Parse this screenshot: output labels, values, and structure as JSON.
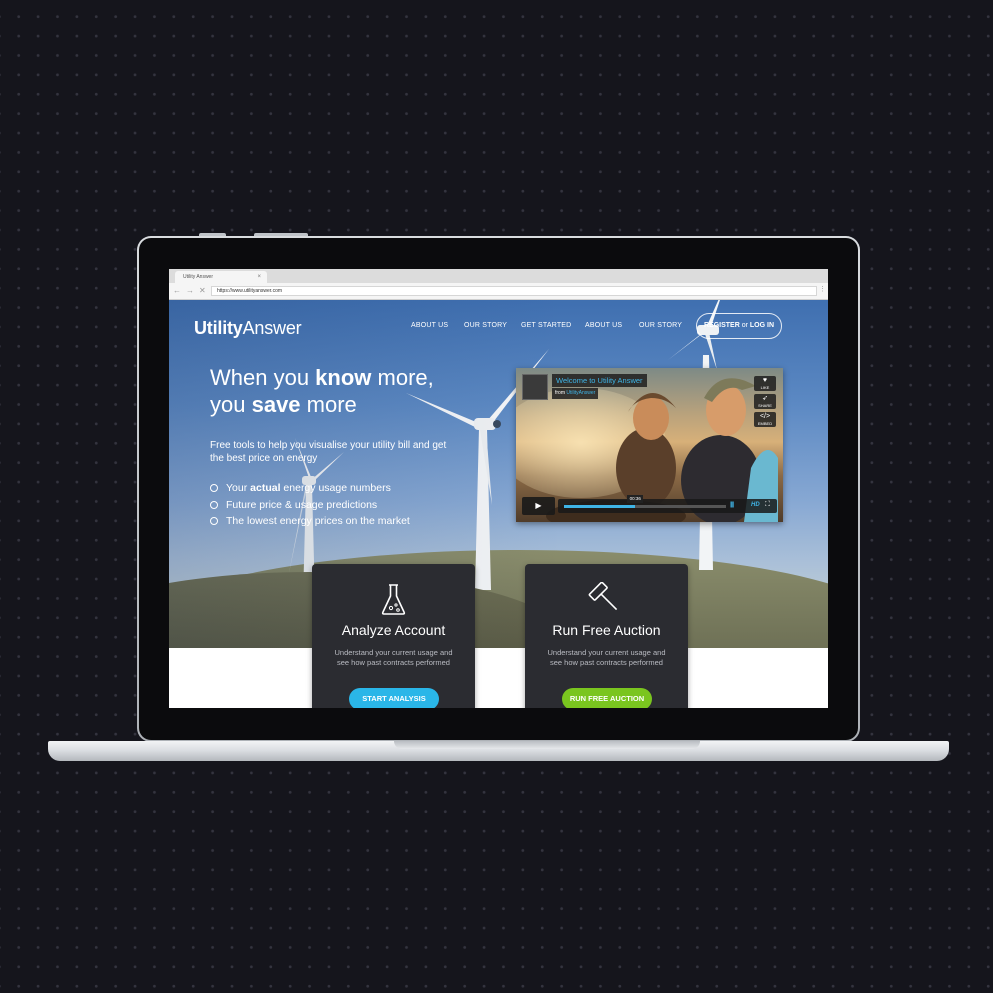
{
  "browser": {
    "tab_title": "Utility Answer",
    "tab_close": "×",
    "back": "←",
    "forward": "→",
    "stop": "✕",
    "url": "https://www.utilityanswer.com",
    "menu": "⋮"
  },
  "header": {
    "logo_bold": "Utility",
    "logo_light": "Answer",
    "nav": [
      "ABOUT US",
      "OUR STORY",
      "GET STARTED",
      "ABOUT US",
      "OUR STORY"
    ],
    "register_label": "REGISTER",
    "register_or": " or ",
    "login_label": "LOG IN"
  },
  "hero": {
    "title_line1_a": "When you ",
    "title_line1_b": "know",
    "title_line1_c": " more,",
    "title_line2_a": "you ",
    "title_line2_b": "save",
    "title_line2_c": " more",
    "subtitle": "Free tools to help you visualise your utility bill and get the best price on energy",
    "bullets": [
      {
        "pre": "Your ",
        "bold": "actual",
        "post": " energy usage numbers"
      },
      {
        "pre": "Future price & usage predictions",
        "bold": "",
        "post": ""
      },
      {
        "pre": "The lowest energy prices on the market",
        "bold": "",
        "post": ""
      }
    ]
  },
  "video": {
    "title": "Welcome to Utility Answer",
    "from_label": "from ",
    "from_link": "UtilityAnswer",
    "like_label": "LIKE",
    "share_label": "SHARE",
    "embed_label": "EMBED",
    "play_icon": "▶",
    "time": "00:36",
    "progress": 0.44,
    "hd_label": "HD",
    "volume_icon": "||||||",
    "fullscreen_icon": "⛶"
  },
  "cards": [
    {
      "title": "Analyze Account",
      "desc": "Understand your current usage and see how past contracts performed",
      "button": "START ANALYSIS",
      "icon": "flask-icon",
      "color": "#2ab6e8"
    },
    {
      "title": "Run Free Auction",
      "desc": "Understand your current usage and see how past contracts performed",
      "button": "RUN FREE AUCTION",
      "icon": "gavel-icon",
      "color": "#7ac51f"
    }
  ]
}
